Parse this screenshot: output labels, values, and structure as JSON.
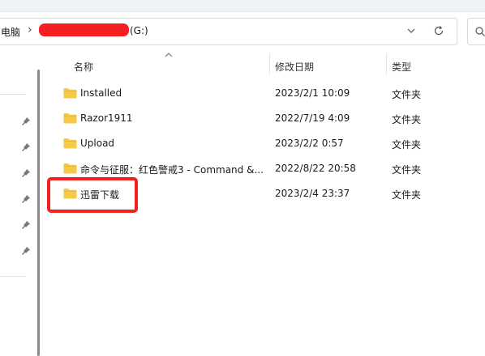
{
  "address_bar": {
    "pc_label": "电脑",
    "separator": "›",
    "drive_label": "(G:)",
    "dropdown_icon": "chevron-down-icon",
    "refresh_icon": "refresh-icon"
  },
  "search": {
    "icon": "search-icon"
  },
  "columns": {
    "name": "名称",
    "date": "修改日期",
    "type": "类型"
  },
  "files": [
    {
      "name": "Installed",
      "date": "2023/2/1 10:09",
      "type": "文件夹"
    },
    {
      "name": "Razor1911",
      "date": "2022/7/19 4:09",
      "type": "文件夹"
    },
    {
      "name": "Upload",
      "date": "2023/2/2 0:57",
      "type": "文件夹"
    },
    {
      "name": "命令与征服：红色警戒3 - Command &...",
      "date": "2022/8/22 20:58",
      "type": "文件夹"
    },
    {
      "name": "迅雷下载",
      "date": "2023/2/4 23:37",
      "type": "文件夹"
    }
  ],
  "colors": {
    "folder": "#f7c948",
    "annotation": "#f41f1f"
  }
}
